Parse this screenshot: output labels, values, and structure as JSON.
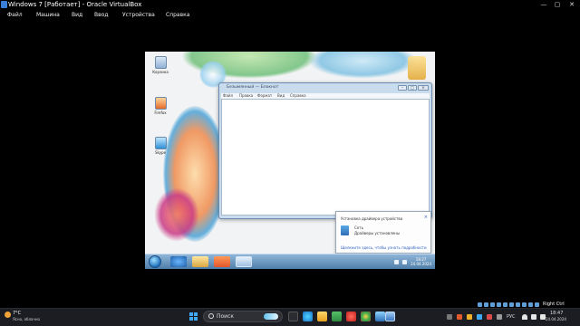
{
  "app": {
    "title": "Windows 7 [Работает] - Oracle VirtualBox",
    "menu": [
      "Файл",
      "Машина",
      "Вид",
      "Ввод",
      "Устройства",
      "Справка"
    ],
    "host_key": "Right Ctrl"
  },
  "guest": {
    "desktop_icons": [
      "Корзина",
      "Firefox",
      "Skype"
    ],
    "notepad": {
      "title": "Безымянный — Блокнот",
      "menu": [
        "Файл",
        "Правка",
        "Формат",
        "Вид",
        "Справка"
      ],
      "content": ""
    },
    "notification": {
      "header": "Установка драйвера устройства",
      "device_name": "Сеть",
      "device_status": "Драйверы установлены",
      "link": "Щелкните здесь, чтобы узнать подробности",
      "close": "×"
    },
    "taskbar": {
      "clock_time": "18:27",
      "clock_date": "24.04.2024"
    }
  },
  "host_taskbar": {
    "weather_temp": "7°C",
    "weather_condition": "Ясно, облачно",
    "search_placeholder": "Поиск",
    "language": "РУС",
    "clock_time": "18:47",
    "clock_date": "24.04.2024"
  },
  "colors": {
    "host_bg": "#000000",
    "host_taskbar": "#1c1d22",
    "guest_taskbar": "#4f7ea8",
    "accent": "#3fa9f5"
  },
  "icons": [
    "virtualbox-logo-icon",
    "minimize-icon",
    "maximize-icon",
    "close-icon",
    "recycle-bin-icon",
    "firefox-icon",
    "skype-icon",
    "windows-start-icon",
    "search-icon",
    "wifi-icon",
    "volume-icon",
    "battery-icon"
  ]
}
